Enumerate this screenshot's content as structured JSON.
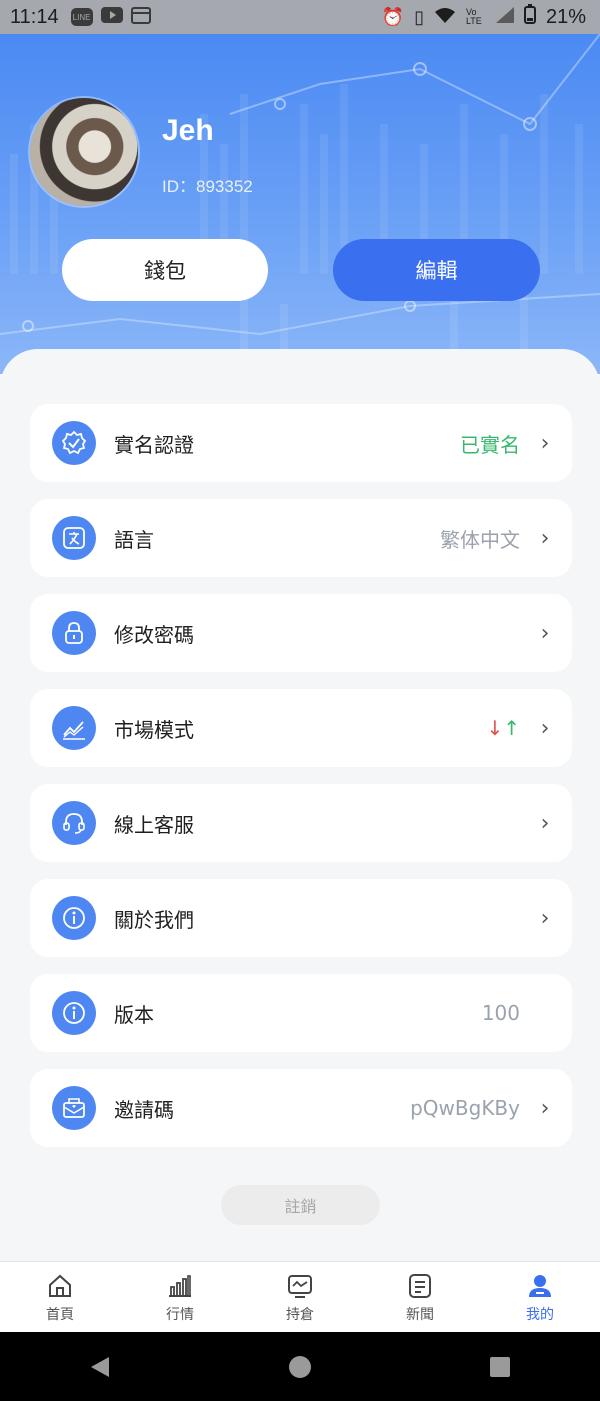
{
  "status_bar": {
    "time": "11:14",
    "left_icons": [
      "line-icon",
      "youtube-icon",
      "calendar-icon"
    ],
    "line_label": "LINE",
    "right_icons": [
      "alarm-icon",
      "vibrate-icon",
      "wifi-icon",
      "volte-icon",
      "signal-icon",
      "battery-icon"
    ],
    "volte_label": "Vo LTE",
    "battery": "21%"
  },
  "profile": {
    "name": "Jeh",
    "id_text": "ID：893352",
    "wallet_label": "錢包",
    "edit_label": "編輯"
  },
  "menu": [
    {
      "label": "實名認證",
      "value": "已實名",
      "icon": "badge-check-icon",
      "chevron": true,
      "value_color": "#38b86d"
    },
    {
      "label": "語言",
      "value": "繁体中文",
      "icon": "translate-icon",
      "chevron": true
    },
    {
      "label": "修改密碼",
      "value": "",
      "icon": "lock-icon",
      "chevron": true
    },
    {
      "label": "市場模式",
      "value": "",
      "icon": "chart-trend-icon",
      "chevron": true,
      "arrows": {
        "down": "↓",
        "up": "↑"
      }
    },
    {
      "label": "線上客服",
      "value": "",
      "icon": "headset-icon",
      "chevron": true
    },
    {
      "label": "關於我們",
      "value": "",
      "icon": "info-icon",
      "chevron": true
    },
    {
      "label": "版本",
      "value": "100",
      "icon": "info-icon",
      "chevron": false
    },
    {
      "label": "邀請碼",
      "value": "pQwBgKBy",
      "icon": "mail-icon",
      "chevron": true
    }
  ],
  "logout_label": "註銷",
  "bottom_nav": [
    {
      "label": "首頁",
      "icon": "home-icon",
      "active": false
    },
    {
      "label": "行情",
      "icon": "bar-chart-icon",
      "active": false
    },
    {
      "label": "持倉",
      "icon": "portfolio-icon",
      "active": false
    },
    {
      "label": "新聞",
      "icon": "news-icon",
      "active": false
    },
    {
      "label": "我的",
      "icon": "user-icon",
      "active": true
    }
  ],
  "colors": {
    "accent": "#3a6ff0",
    "icon_bg": "#4f87f2",
    "verified": "#38b86d",
    "down": "#e0544b",
    "up": "#38b86d"
  }
}
